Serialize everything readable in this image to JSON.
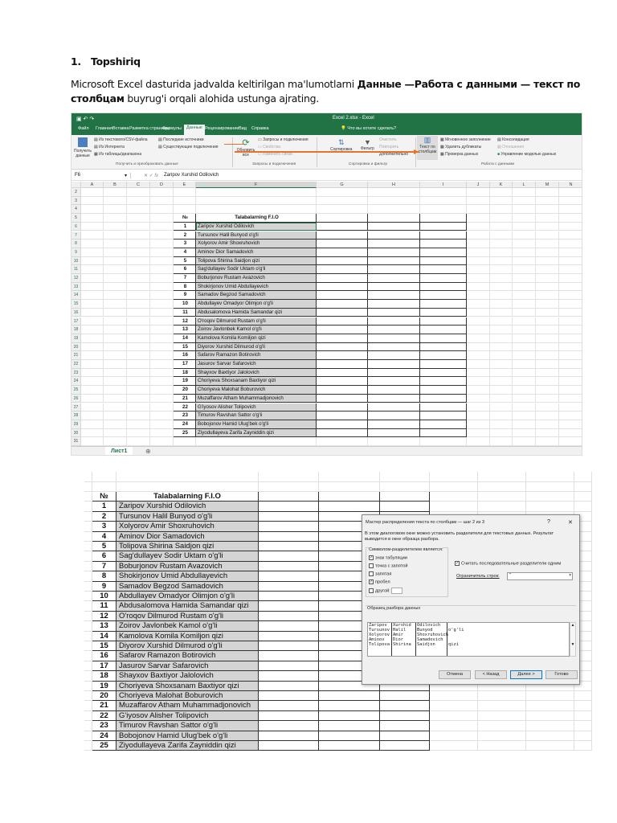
{
  "doc": {
    "heading_num": "1.",
    "heading": "Topshiriq",
    "p1_a": "Microsoft Excel dasturida jadvalda keltirilgan ma'lumotlarni ",
    "p1_b": "Данные —Работа с данными — текст по",
    "p2_b": "столбцам",
    "p2_a": "  buyrug'i orqali alohida ustunga ajrating."
  },
  "excel": {
    "title": "Excel 2.xlsx - Excel",
    "tell_me": "Что вы хотите сделать?",
    "tabs": [
      "Файл",
      "Главная",
      "Вставка",
      "Разметка страницы",
      "Формулы",
      "Данные",
      "Рецензирование",
      "Вид",
      "Справка"
    ],
    "active_tab": "Данные",
    "ribbon": {
      "get_data": "Получить данные",
      "from_csv": "Из текстового/CSV-файла",
      "from_web": "Из Интернета",
      "from_table": "Из таблицы/диапазона",
      "recent": "Последние источники",
      "existing": "Существующие подключения",
      "group1": "Получить и преобразовать данные",
      "refresh": "Обновить все",
      "queries": "Запросы и подключения",
      "props": "Свойства",
      "edit_links": "Изменить связи",
      "group2": "Запросы и подключения",
      "sort": "Сортировка",
      "filter": "Фильтр",
      "clear": "Очистить",
      "reapply": "Повторить",
      "advanced": "Дополнительно",
      "group3": "Сортировка и фильтр",
      "text_to_cols": "Текст по столбцам",
      "flash_fill": "Мгновенное заполнение",
      "remove_dup": "Удалить дубликаты",
      "validation": "Проверка данных",
      "consolidate": "Консолидация",
      "relations": "Отношения",
      "data_model": "Управление моделью данных",
      "group4": "Работа с данными"
    },
    "name_box": "F6",
    "fx": "fx",
    "formula": "Zaripov Xurshid Odilovich",
    "columns": [
      "A",
      "B",
      "C",
      "D",
      "E",
      "F",
      "G",
      "H",
      "I",
      "J",
      "K",
      "L",
      "M",
      "N"
    ],
    "sheet_tab": "Лист1",
    "accent": "#217346"
  },
  "table": {
    "col_num": "№",
    "col_name": "Talabalarning F.I.O",
    "rows": [
      [
        "1",
        "Zaripov Xurshid Odilovich"
      ],
      [
        "2",
        "Tursunov Halil Bunyod o'g'li"
      ],
      [
        "3",
        "Xolyorov Amir Shoxruhovich"
      ],
      [
        "4",
        "Aminov Dior Samadovich"
      ],
      [
        "5",
        "Tolipova Shirina Saidjon qizi"
      ],
      [
        "6",
        "Sag'dullayev Sodir Uktam o'g'li"
      ],
      [
        "7",
        "Boburjonov Rustam Avazovich"
      ],
      [
        "8",
        "Shokirjonov Umid Abdullayevich"
      ],
      [
        "9",
        "Samadov Begzod Samadovich"
      ],
      [
        "10",
        "Abdullayev Omadyor Olimjon o'g'li"
      ],
      [
        "11",
        "Abdusalomova Hamida Samandar qizi"
      ],
      [
        "12",
        "O'roqov Dilmurod Rustam o'g'li"
      ],
      [
        "13",
        "Zoirov Javlonbek Kamol o'g'li"
      ],
      [
        "14",
        "Kamolova Komila Komiljon qizi"
      ],
      [
        "15",
        "Diyorov Xurshid Dilmurod o'g'li"
      ],
      [
        "16",
        "Safarov Ramazon Botirovich"
      ],
      [
        "17",
        "Jasurov Sarvar Safarovich"
      ],
      [
        "18",
        "Shayxov Baxtiyor Jalolovich"
      ],
      [
        "19",
        "Choriyeva Shoxsanam Baxtiyor qizi"
      ],
      [
        "20",
        "Choriyeva Malohat Boburovich"
      ],
      [
        "21",
        "Muzaffarov Atham Muhammadjonovich"
      ],
      [
        "22",
        "G'iyosov Alisher Tolipovich"
      ],
      [
        "23",
        "Timurov Ravshan Sattor o'g'li"
      ],
      [
        "24",
        "Bobojonov Hamid Ulug'bek o'g'li"
      ],
      [
        "25",
        "Ziyodullayeva Zarifa Zayniddin qizi"
      ]
    ]
  },
  "dialog": {
    "title": "Мастер распределения текста по столбцам — шаг 2 из 3",
    "help": "?",
    "close": "✕",
    "desc": "В этом диалоговом окне можно установить разделители для текстовых данных. Результат выводится в окне образца разбора.",
    "group": "Символом-разделителем является:",
    "options": [
      {
        "label": "знак табуляции",
        "checked": true
      },
      {
        "label": "точка с запятой",
        "checked": false
      },
      {
        "label": "запятая",
        "checked": false
      },
      {
        "label": "пробел",
        "checked": true
      },
      {
        "label": "другой:",
        "checked": false
      }
    ],
    "consecutive": "Считать последовательные разделители одним",
    "consecutive_checked": true,
    "qualifier_label": "Ограничитель строк:",
    "qualifier_value": "\"",
    "preview_label": "Образец разбора данных",
    "preview": [
      [
        "Zaripov",
        "Xurshid",
        "Odilovich",
        ""
      ],
      [
        "Tursunov",
        "Halil",
        "Bunyod",
        "o'g'li"
      ],
      [
        "Xolyorov",
        "Amir",
        "Shoxruhovich",
        ""
      ],
      [
        "Aminov",
        "Dior",
        "Samadovich",
        ""
      ],
      [
        "Tolipova",
        "Shirina",
        "Saidjon",
        "qizi"
      ]
    ],
    "buttons": {
      "cancel": "Отмена",
      "back": "< Назад",
      "next": "Далее >",
      "finish": "Готово"
    }
  }
}
